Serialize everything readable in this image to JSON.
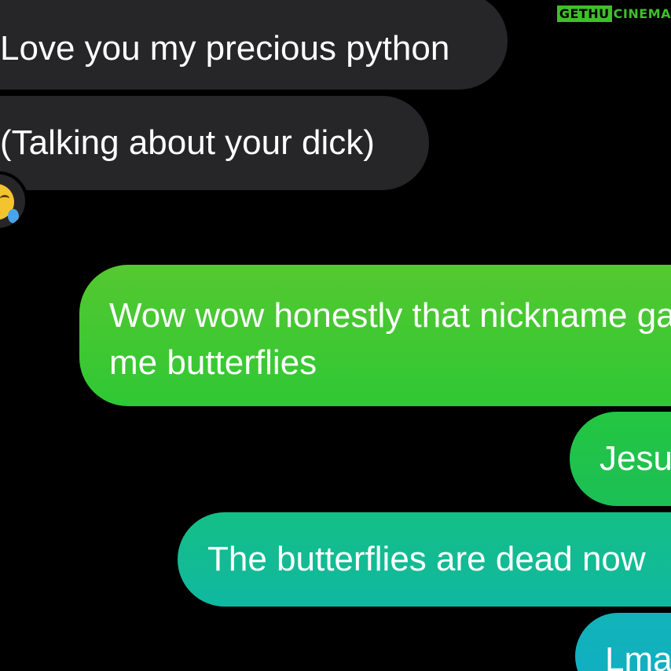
{
  "watermark": {
    "part1": "GETHU",
    "part2": "CINEMA"
  },
  "messages": {
    "received": [
      {
        "text": "Love you my precious python"
      },
      {
        "text": "(Talking about your dick)"
      }
    ],
    "reaction": {
      "emoji": "face-with-tears-of-joy-icon"
    },
    "sent": [
      {
        "text": "Wow wow honestly that nickname gave me butterflies"
      },
      {
        "text": "Jesus"
      },
      {
        "text": "The butterflies are dead now"
      },
      {
        "text": "Lmao"
      }
    ]
  },
  "colors": {
    "background": "#000000",
    "received_bubble": "#262628",
    "sent_green": "#3ec832",
    "sent_teal": "#10b8a8",
    "watermark_green": "#3fbf2a"
  }
}
